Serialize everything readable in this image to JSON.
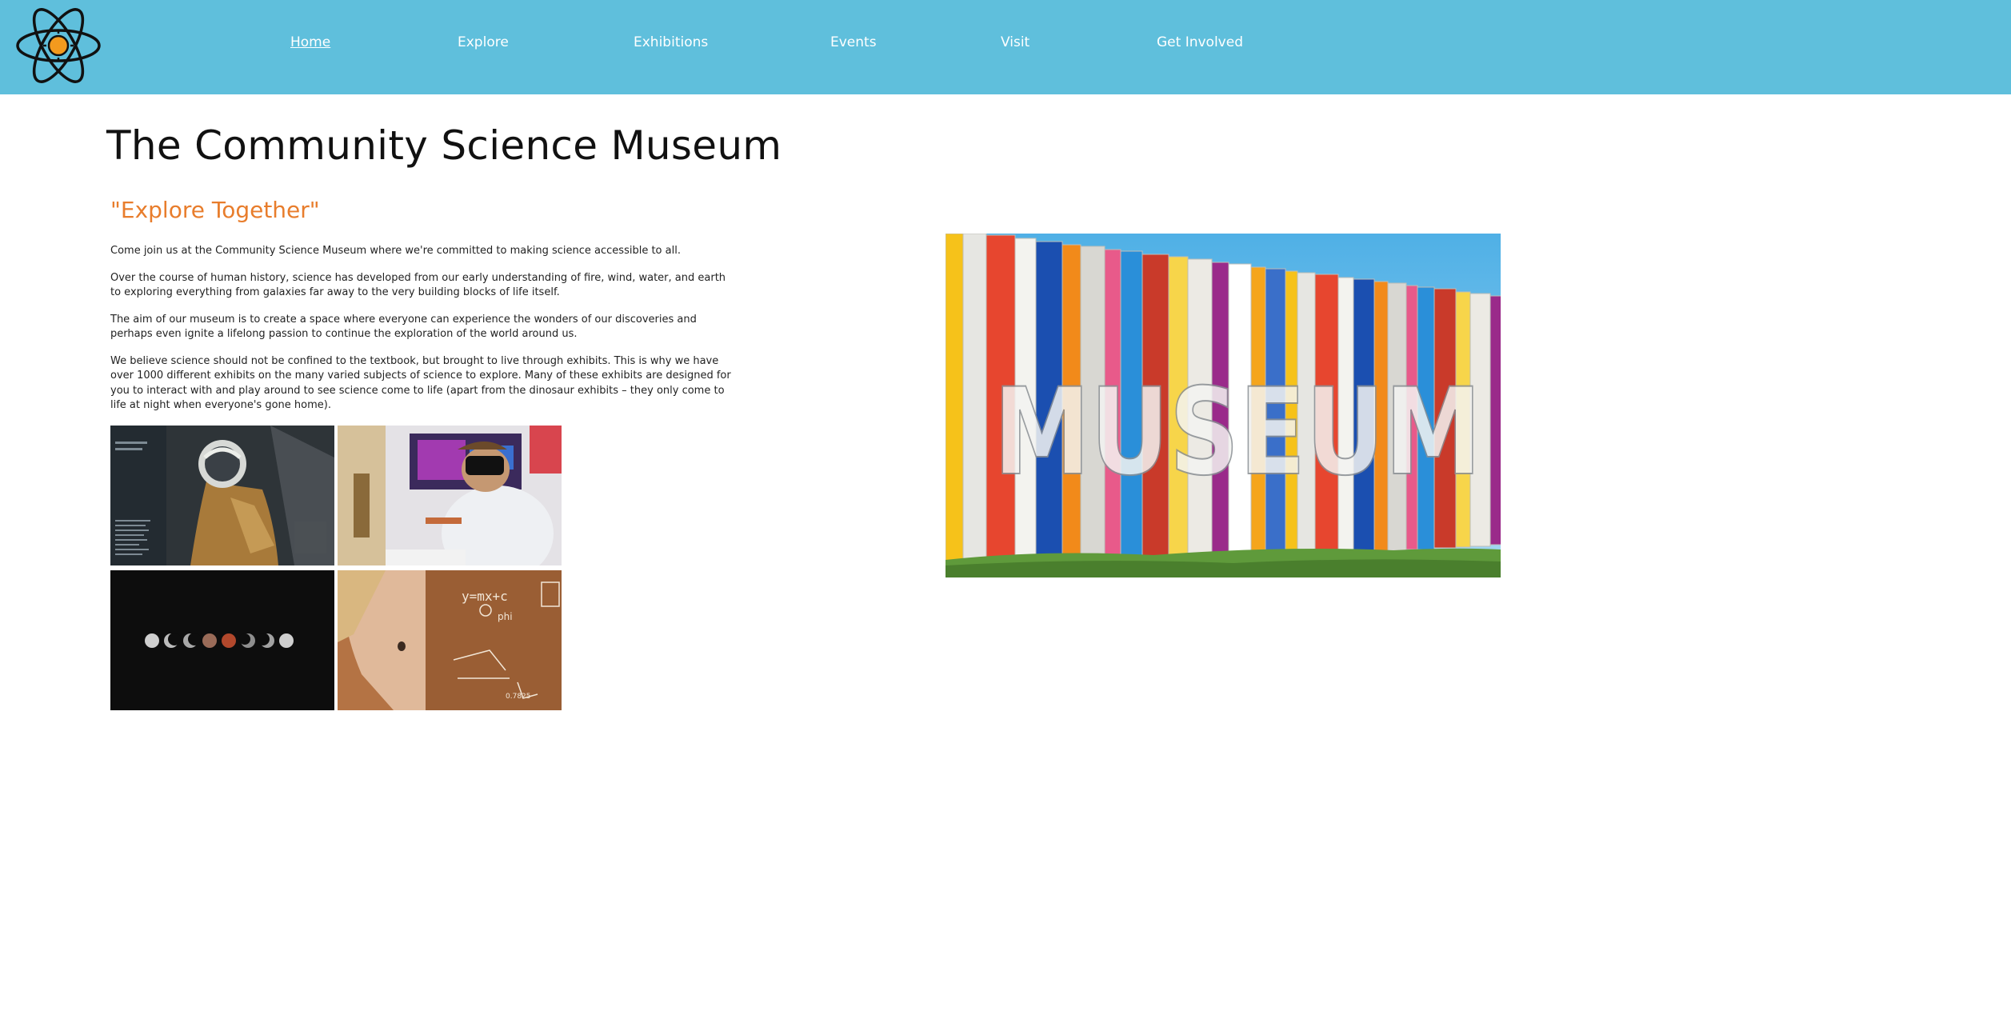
{
  "header": {
    "logo_icon": "atom-icon",
    "nav": [
      {
        "label": "Home",
        "active": true
      },
      {
        "label": "Explore",
        "active": false
      },
      {
        "label": "Exhibitions",
        "active": false
      },
      {
        "label": "Events",
        "active": false
      },
      {
        "label": "Visit",
        "active": false
      },
      {
        "label": "Get Involved",
        "active": false
      }
    ]
  },
  "main": {
    "title": "The Community Science Museum",
    "tagline": "\"Explore Together\"",
    "paragraphs": [
      "Come join us at the Community Science Museum where we're committed to making science accessible to all.",
      "Over the course of human history, science has developed from our early understanding of fire, wind, water, and earth to exploring everything from galaxies far away to the very building blocks of life itself.",
      "The aim of our museum is to create a space where everyone can experience the wonders of our discoveries and perhaps even ignite a lifelong passion to continue the exploration of the world around us.",
      "We believe science should not be confined to the textbook, but brought to live through exhibits. This is why we have over 1000 different exhibits on the many varied subjects of science to explore. Many of these exhibits are designed for you to interact with and play around to see science come to life (apart from the dinosaur exhibits – they only come to life at night when everyone's gone home)."
    ],
    "gallery_icons": [
      "astronaut-suit-photo",
      "vr-headset-photo",
      "moon-phases-photo",
      "child-chalkboard-photo"
    ],
    "chalkboard_text": {
      "equation": "y=mx+c",
      "phi": "phi",
      "number": "0.7825"
    }
  },
  "hero": {
    "icon": "museum-sign-photo",
    "sign_text": "MUSEUM"
  },
  "colors": {
    "header_bg": "#5fbfdc",
    "tagline": "#e87d2c",
    "nav_text": "#ffffff",
    "title": "#111111"
  }
}
